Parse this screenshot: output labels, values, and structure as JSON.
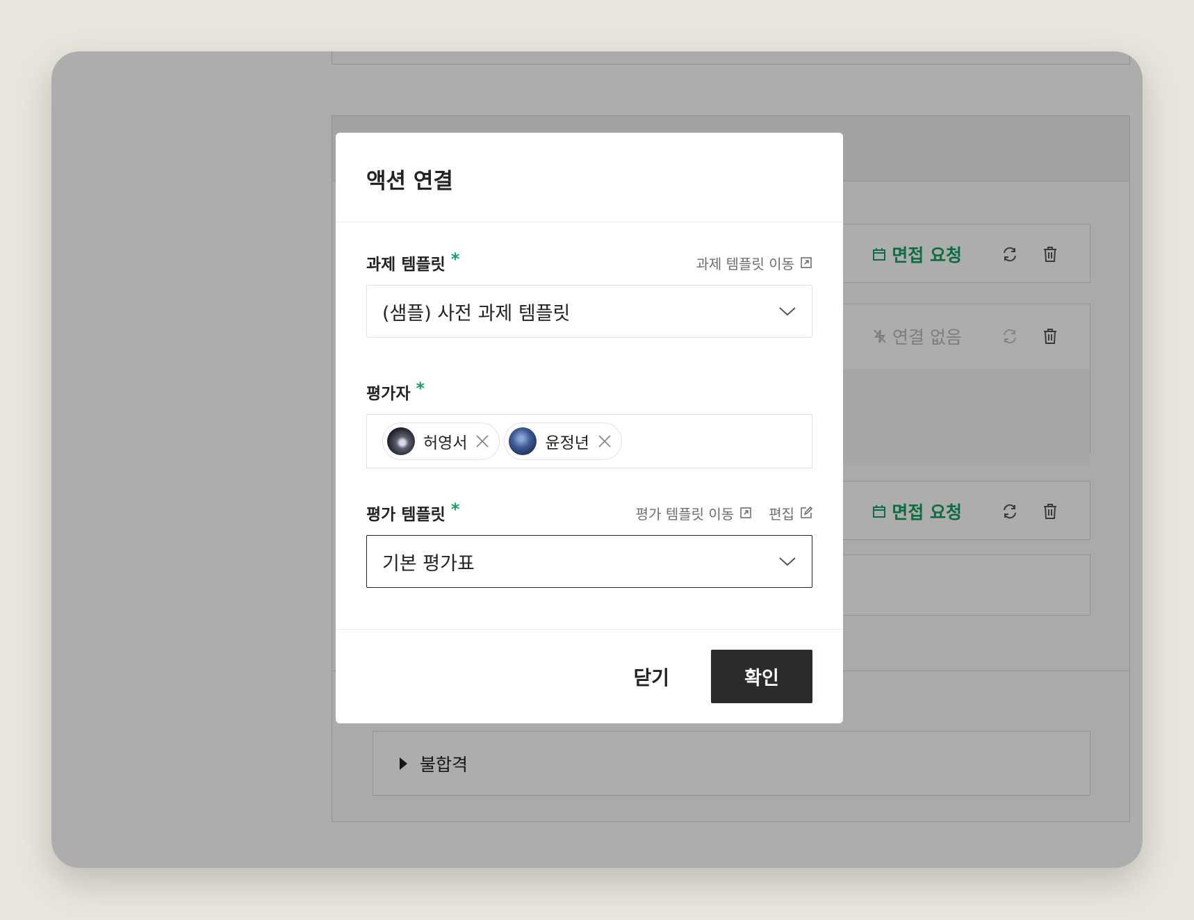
{
  "modal": {
    "title": "액션 연결",
    "task_template": {
      "label": "과제 템플릿",
      "required_mark": "*",
      "link_label": "과제 템플릿 이동",
      "value": "(샘플) 사전 과제 템플릿"
    },
    "evaluators": {
      "label": "평가자",
      "required_mark": "*",
      "people": [
        {
          "name": "허영서"
        },
        {
          "name": "윤정년"
        }
      ]
    },
    "eval_template": {
      "label": "평가 템플릿",
      "required_mark": "*",
      "link_label": "평가 템플릿 이동",
      "edit_label": "편집",
      "value": "기본 평가표"
    },
    "close_label": "닫기",
    "confirm_label": "확인"
  },
  "background": {
    "rows": [
      {
        "action": "면접 요청",
        "state": "linked"
      },
      {
        "action": "연결 없음",
        "state": "none"
      },
      {
        "action": "면접 요청",
        "state": "linked"
      }
    ],
    "fail_section": "불합격"
  },
  "colors": {
    "accent_green": "#14a060",
    "primary_button": "#2b2b2b"
  }
}
